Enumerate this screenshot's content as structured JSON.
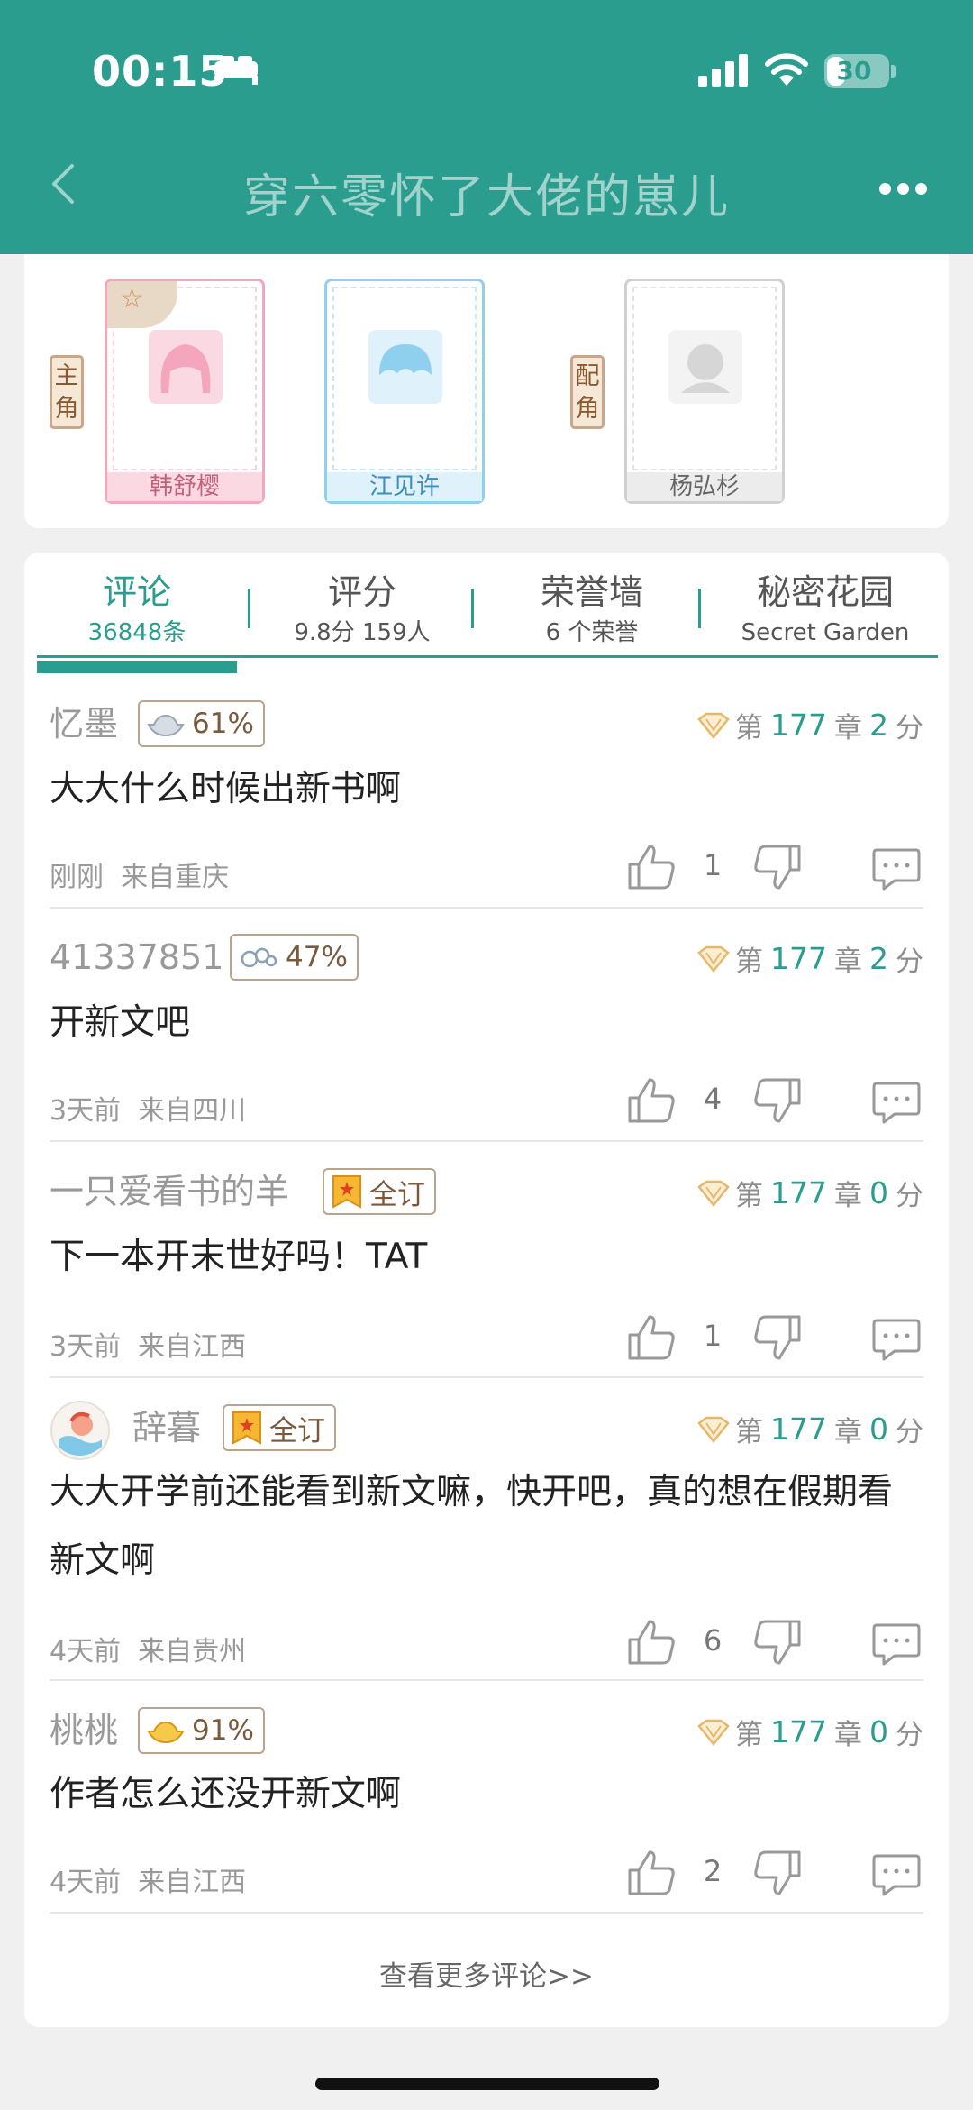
{
  "status_bar": {
    "time": "00:15",
    "battery": "30",
    "battery_level": 0.3
  },
  "header": {
    "title": "穿六零怀了大佬的崽儿"
  },
  "characters": {
    "main_tag": "主角",
    "support_tag": "配角",
    "items": [
      {
        "name": "韩舒樱",
        "color": "#f4a6bd"
      },
      {
        "name": "江见许",
        "color": "#8fd0ef"
      },
      {
        "name": "杨弘杉",
        "color": "#d0d0d0"
      }
    ]
  },
  "tabs": [
    {
      "label": "评论",
      "sub": "36848条"
    },
    {
      "label": "评分",
      "sub": "9.8分 159人"
    },
    {
      "label": "荣誉墙",
      "sub": "6 个荣誉"
    },
    {
      "label": "秘密花园",
      "sub": "Secret Garden"
    }
  ],
  "comments": [
    {
      "user": "忆墨",
      "badge": "61%",
      "badge_icon": "silver-ingot-icon",
      "chapter_prefix": "第",
      "chapter": "177",
      "chapter_suffix": "章",
      "score": "2",
      "score_unit": "分",
      "text": "大大什么时候出新书啊",
      "time": "刚刚",
      "location": "来自重庆",
      "likes": "1"
    },
    {
      "user": "41337851",
      "badge": "47%",
      "badge_icon": "cloud-icon",
      "chapter_prefix": "第",
      "chapter": "177",
      "chapter_suffix": "章",
      "score": "2",
      "score_unit": "分",
      "text": "开新文吧",
      "time": "3天前",
      "location": "来自四川",
      "likes": "4"
    },
    {
      "user": "一只爱看书的羊",
      "badge": "全订",
      "badge_icon": "bookmark-icon",
      "chapter_prefix": "第",
      "chapter": "177",
      "chapter_suffix": "章",
      "score": "0",
      "score_unit": "分",
      "text": "下一本开末世好吗！TAT",
      "time": "3天前",
      "location": "来自江西",
      "likes": "1"
    },
    {
      "user": "辞暮",
      "badge": "全订",
      "badge_icon": "bookmark-icon",
      "chapter_prefix": "第",
      "chapter": "177",
      "chapter_suffix": "章",
      "score": "0",
      "score_unit": "分",
      "text": "大大开学前还能看到新文嘛，快开吧，真的想在假期看新文啊",
      "time": "4天前",
      "location": "来自贵州",
      "likes": "6"
    },
    {
      "user": "桃桃",
      "badge": "91%",
      "badge_icon": "gold-ingot-icon",
      "chapter_prefix": "第",
      "chapter": "177",
      "chapter_suffix": "章",
      "score": "0",
      "score_unit": "分",
      "text": "作者怎么还没开新文啊",
      "time": "4天前",
      "location": "来自江西",
      "likes": "2"
    }
  ],
  "more_comments": "查看更多评论>>",
  "colors": {
    "accent": "#2a9d8f",
    "chapter_gem": "#e5b86b"
  }
}
